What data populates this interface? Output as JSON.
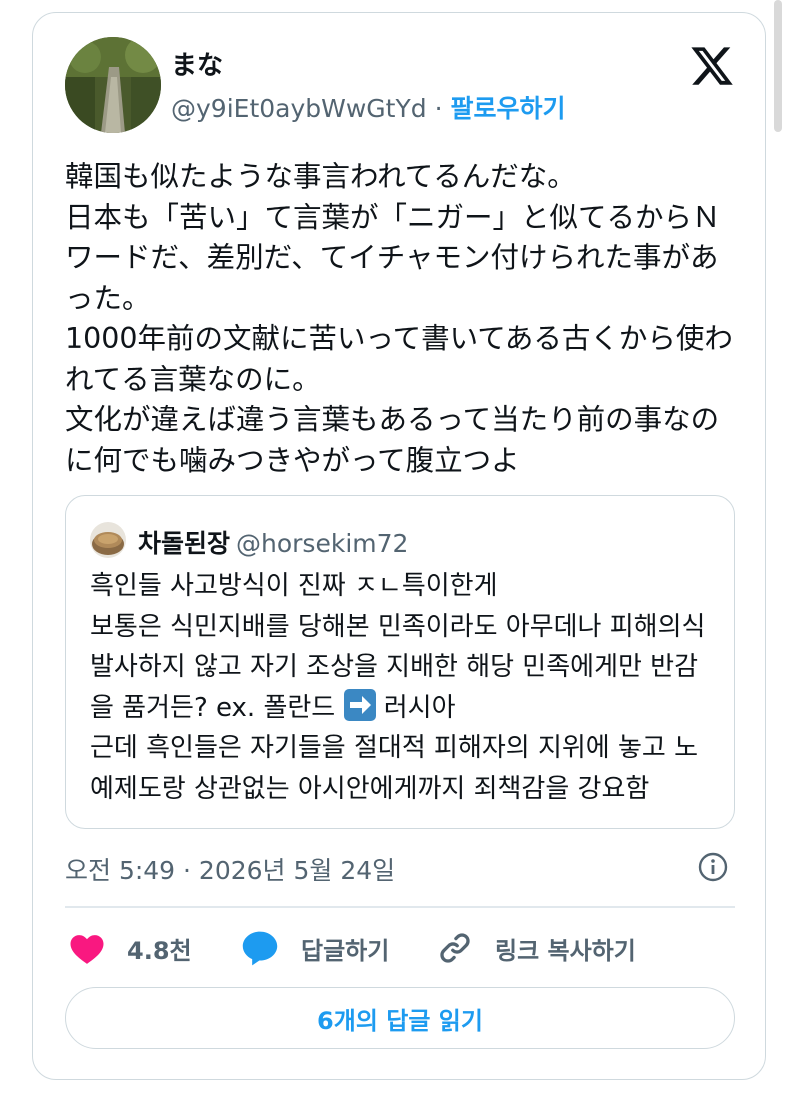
{
  "tweet": {
    "display_name": "まな",
    "handle": "@y9iEt0aybWwGtYd",
    "separator": "·",
    "follow_label": "팔로우하기",
    "text": "韓国も似たような事言われてるんだな。\n日本も「苦い」て言葉が「ニガー」と似てるからＮワードだ、差別だ、てイチャモン付けられた事があった。\n1000年前の文献に苦いって書いてある古くから使われてる言葉なのに。\n文化が違えば違う言葉もあるって当たり前の事なのに何でも噛みつきやがって腹立つよ",
    "timestamp": "오전 5:49 · 2026년 5월 24일"
  },
  "quote": {
    "display_name": "차돌된장",
    "handle": "@horsekim72",
    "text_before_emoji": "흑인들 사고방식이 진짜 ㅈㄴ특이한게\n보통은 식민지배를 당해본 민족이라도 아무데나 피해의식 발사하지 않고 자기 조상을 지배한 해당 민족에게만 반감을 품거든? ex. 폴란드 ",
    "text_after_emoji": " 러시아\n근데 흑인들은 자기들을 절대적 피해자의 지위에 놓고 노예제도랑 상관없는 아시안에게까지 죄책감을 강요함",
    "emoji_icon": "right-arrow-emoji"
  },
  "actions": {
    "like_count": "4.8천",
    "reply_label": "답글하기",
    "copy_link_label": "링크 복사하기"
  },
  "read_replies_label": "6개의 답글 읽기",
  "colors": {
    "accent": "#1d9bf0",
    "like": "#f91880",
    "reply_icon": "#1d9bf0",
    "secondary_text": "#536471",
    "border": "#cfd9de"
  }
}
